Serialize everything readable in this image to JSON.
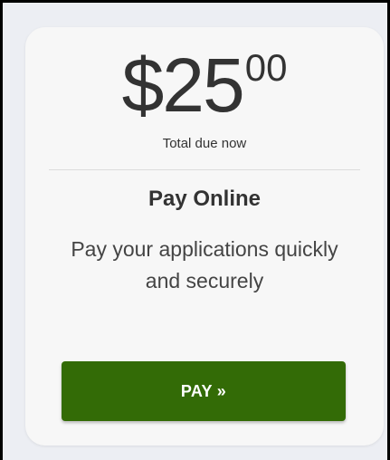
{
  "payment_card": {
    "amount_whole": "$25",
    "amount_cents": "00",
    "amount_caption": "Total due now",
    "heading": "Pay Online",
    "description": "Pay your applications quickly and securely",
    "pay_button_label": "PAY »"
  },
  "colors": {
    "button_background": "#336b06",
    "button_text": "#ffffff",
    "card_background": "#f7f7f7",
    "page_background": "#eceef3",
    "text": "#333333"
  }
}
